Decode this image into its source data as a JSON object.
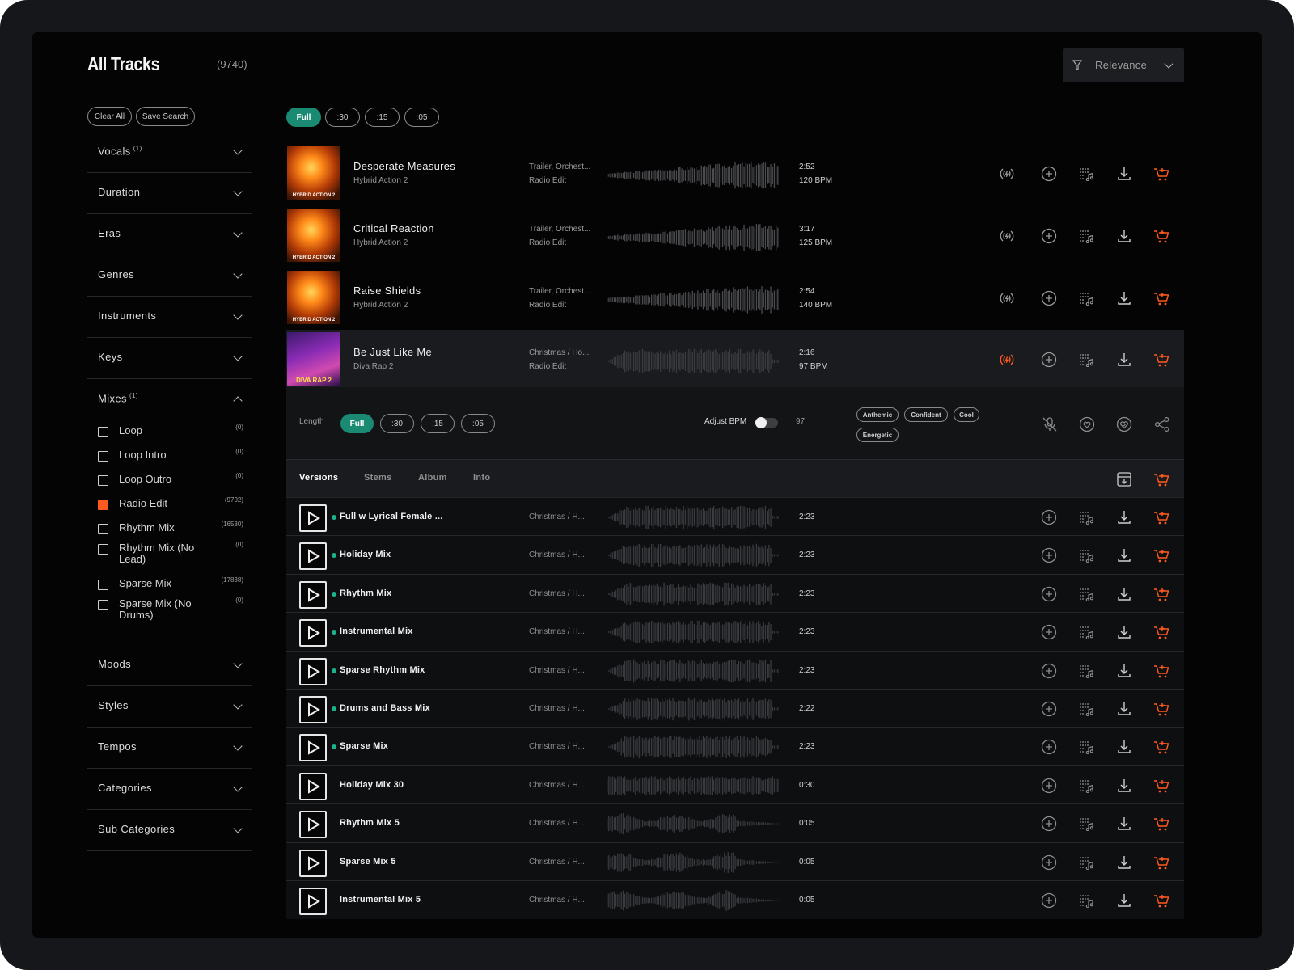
{
  "header": {
    "title": "All Tracks",
    "count": "(9740)",
    "sort_label": "Relevance"
  },
  "sidebar": {
    "clear_all": "Clear All",
    "save_search": "Save Search",
    "filters_top": [
      {
        "label": "Vocals",
        "sup": "(1)"
      },
      {
        "label": "Duration",
        "sup": ""
      },
      {
        "label": "Eras",
        "sup": ""
      },
      {
        "label": "Genres",
        "sup": ""
      },
      {
        "label": "Instruments",
        "sup": ""
      },
      {
        "label": "Keys",
        "sup": ""
      },
      {
        "label": "Mixes",
        "sup": "(1)"
      }
    ],
    "mix_options": [
      {
        "label": "Loop",
        "count": "(0)",
        "checked": false
      },
      {
        "label": "Loop Intro",
        "count": "(0)",
        "checked": false
      },
      {
        "label": "Loop Outro",
        "count": "(0)",
        "checked": false
      },
      {
        "label": "Radio Edit",
        "count": "(9792)",
        "checked": true
      },
      {
        "label": "Rhythm Mix",
        "count": "(16530)",
        "checked": false
      },
      {
        "label": "Rhythm Mix (No Lead)",
        "count": "(0)",
        "checked": false
      },
      {
        "label": "Sparse Mix",
        "count": "(17838)",
        "checked": false
      },
      {
        "label": "Sparse Mix (No Drums)",
        "count": "(0)",
        "checked": false
      }
    ],
    "filters_bottom": [
      {
        "label": "Moods"
      },
      {
        "label": "Styles"
      },
      {
        "label": "Tempos"
      },
      {
        "label": "Categories"
      },
      {
        "label": "Sub Categories"
      }
    ]
  },
  "length_filters": [
    "Full",
    ":30",
    ":15",
    ":05"
  ],
  "tracks": [
    {
      "title": "Desperate Measures",
      "album": "Hybrid Action 2",
      "genre": "Trailer, Orchest...",
      "version": "Radio Edit",
      "duration": "2:52",
      "bpm": "120 BPM",
      "art_caption": "HYBRID ACTION 2"
    },
    {
      "title": "Critical Reaction",
      "album": "Hybrid Action 2",
      "genre": "Trailer, Orchest...",
      "version": "Radio Edit",
      "duration": "3:17",
      "bpm": "125 BPM",
      "art_caption": "HYBRID ACTION 2"
    },
    {
      "title": "Raise Shields",
      "album": "Hybrid Action 2",
      "genre": "Trailer, Orchest...",
      "version": "Radio Edit",
      "duration": "2:54",
      "bpm": "140 BPM",
      "art_caption": "HYBRID ACTION 2"
    },
    {
      "title": "Be Just Like Me",
      "album": "Diva Rap 2",
      "genre": "Christmas / Ho...",
      "version": "Radio Edit",
      "duration": "2:16",
      "bpm": "97 BPM",
      "art_caption": "DIVA RAP 2"
    }
  ],
  "panel": {
    "length_label": "Length",
    "lengths": [
      "Full",
      ":30",
      ":15",
      ":05"
    ],
    "adjust_bpm_label": "Adjust BPM",
    "bpm_value": "97",
    "tags": [
      "Anthemic",
      "Confident",
      "Cool",
      "Energetic"
    ]
  },
  "tabs": [
    "Versions",
    "Stems",
    "Album",
    "Info"
  ],
  "versions": [
    {
      "name": "Full w Lyrical Female ...",
      "genre": "Christmas / H...",
      "duration": "2:23",
      "dot": true
    },
    {
      "name": "Holiday Mix",
      "genre": "Christmas / H...",
      "duration": "2:23",
      "dot": true
    },
    {
      "name": "Rhythm Mix",
      "genre": "Christmas / H...",
      "duration": "2:23",
      "dot": true
    },
    {
      "name": "Instrumental Mix",
      "genre": "Christmas / H...",
      "duration": "2:23",
      "dot": true
    },
    {
      "name": "Sparse Rhythm Mix",
      "genre": "Christmas / H...",
      "duration": "2:23",
      "dot": true
    },
    {
      "name": "Drums and Bass Mix",
      "genre": "Christmas / H...",
      "duration": "2:22",
      "dot": true
    },
    {
      "name": "Sparse Mix",
      "genre": "Christmas / H...",
      "duration": "2:23",
      "dot": true
    },
    {
      "name": "Holiday Mix 30",
      "genre": "Christmas / H...",
      "duration": "0:30",
      "dot": false
    },
    {
      "name": "Rhythm Mix 5",
      "genre": "Christmas / H...",
      "duration": "0:05",
      "dot": false
    },
    {
      "name": "Sparse Mix 5",
      "genre": "Christmas / H...",
      "duration": "0:05",
      "dot": false
    },
    {
      "name": "Instrumental Mix 5",
      "genre": "Christmas / H...",
      "duration": "0:05",
      "dot": false
    }
  ],
  "colors": {
    "accent": "#1b8a72",
    "cart": "#ff5a1f",
    "active_icon": "#ff5a1f"
  }
}
